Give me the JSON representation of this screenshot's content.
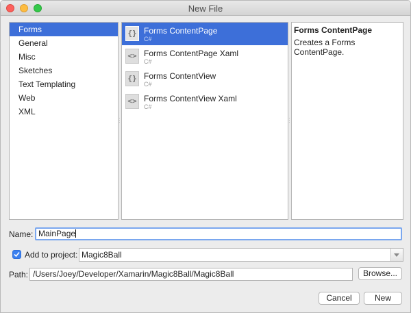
{
  "window": {
    "title": "New File"
  },
  "categories": [
    {
      "label": "Forms",
      "selected": true
    },
    {
      "label": "General"
    },
    {
      "label": "Misc"
    },
    {
      "label": "Sketches"
    },
    {
      "label": "Text Templating"
    },
    {
      "label": "Web"
    },
    {
      "label": "XML"
    }
  ],
  "templates": [
    {
      "name": "Forms ContentPage",
      "lang": "C#",
      "icon": "curly-braces-icon",
      "glyph": "{}",
      "selected": true
    },
    {
      "name": "Forms ContentPage Xaml",
      "lang": "C#",
      "icon": "angle-brackets-icon",
      "glyph": "<>"
    },
    {
      "name": "Forms ContentView",
      "lang": "C#",
      "icon": "curly-braces-icon",
      "glyph": "{}"
    },
    {
      "name": "Forms ContentView Xaml",
      "lang": "C#",
      "icon": "angle-brackets-icon",
      "glyph": "<>"
    }
  ],
  "description": {
    "title": "Forms ContentPage",
    "text": "Creates a Forms ContentPage."
  },
  "form": {
    "name_label": "Name:",
    "name_value": "MainPage",
    "add_to_project_label": "Add to project:",
    "add_to_project_checked": true,
    "project_value": "Magic8Ball",
    "path_label": "Path:",
    "path_value": "/Users/Joey/Developer/Xamarin/Magic8Ball/Magic8Ball",
    "browse_label": "Browse..."
  },
  "actions": {
    "cancel_label": "Cancel",
    "new_label": "New"
  },
  "colors": {
    "selection": "#3d6fd9",
    "checkbox": "#3b80f0",
    "focus": "#7aa7ef"
  }
}
